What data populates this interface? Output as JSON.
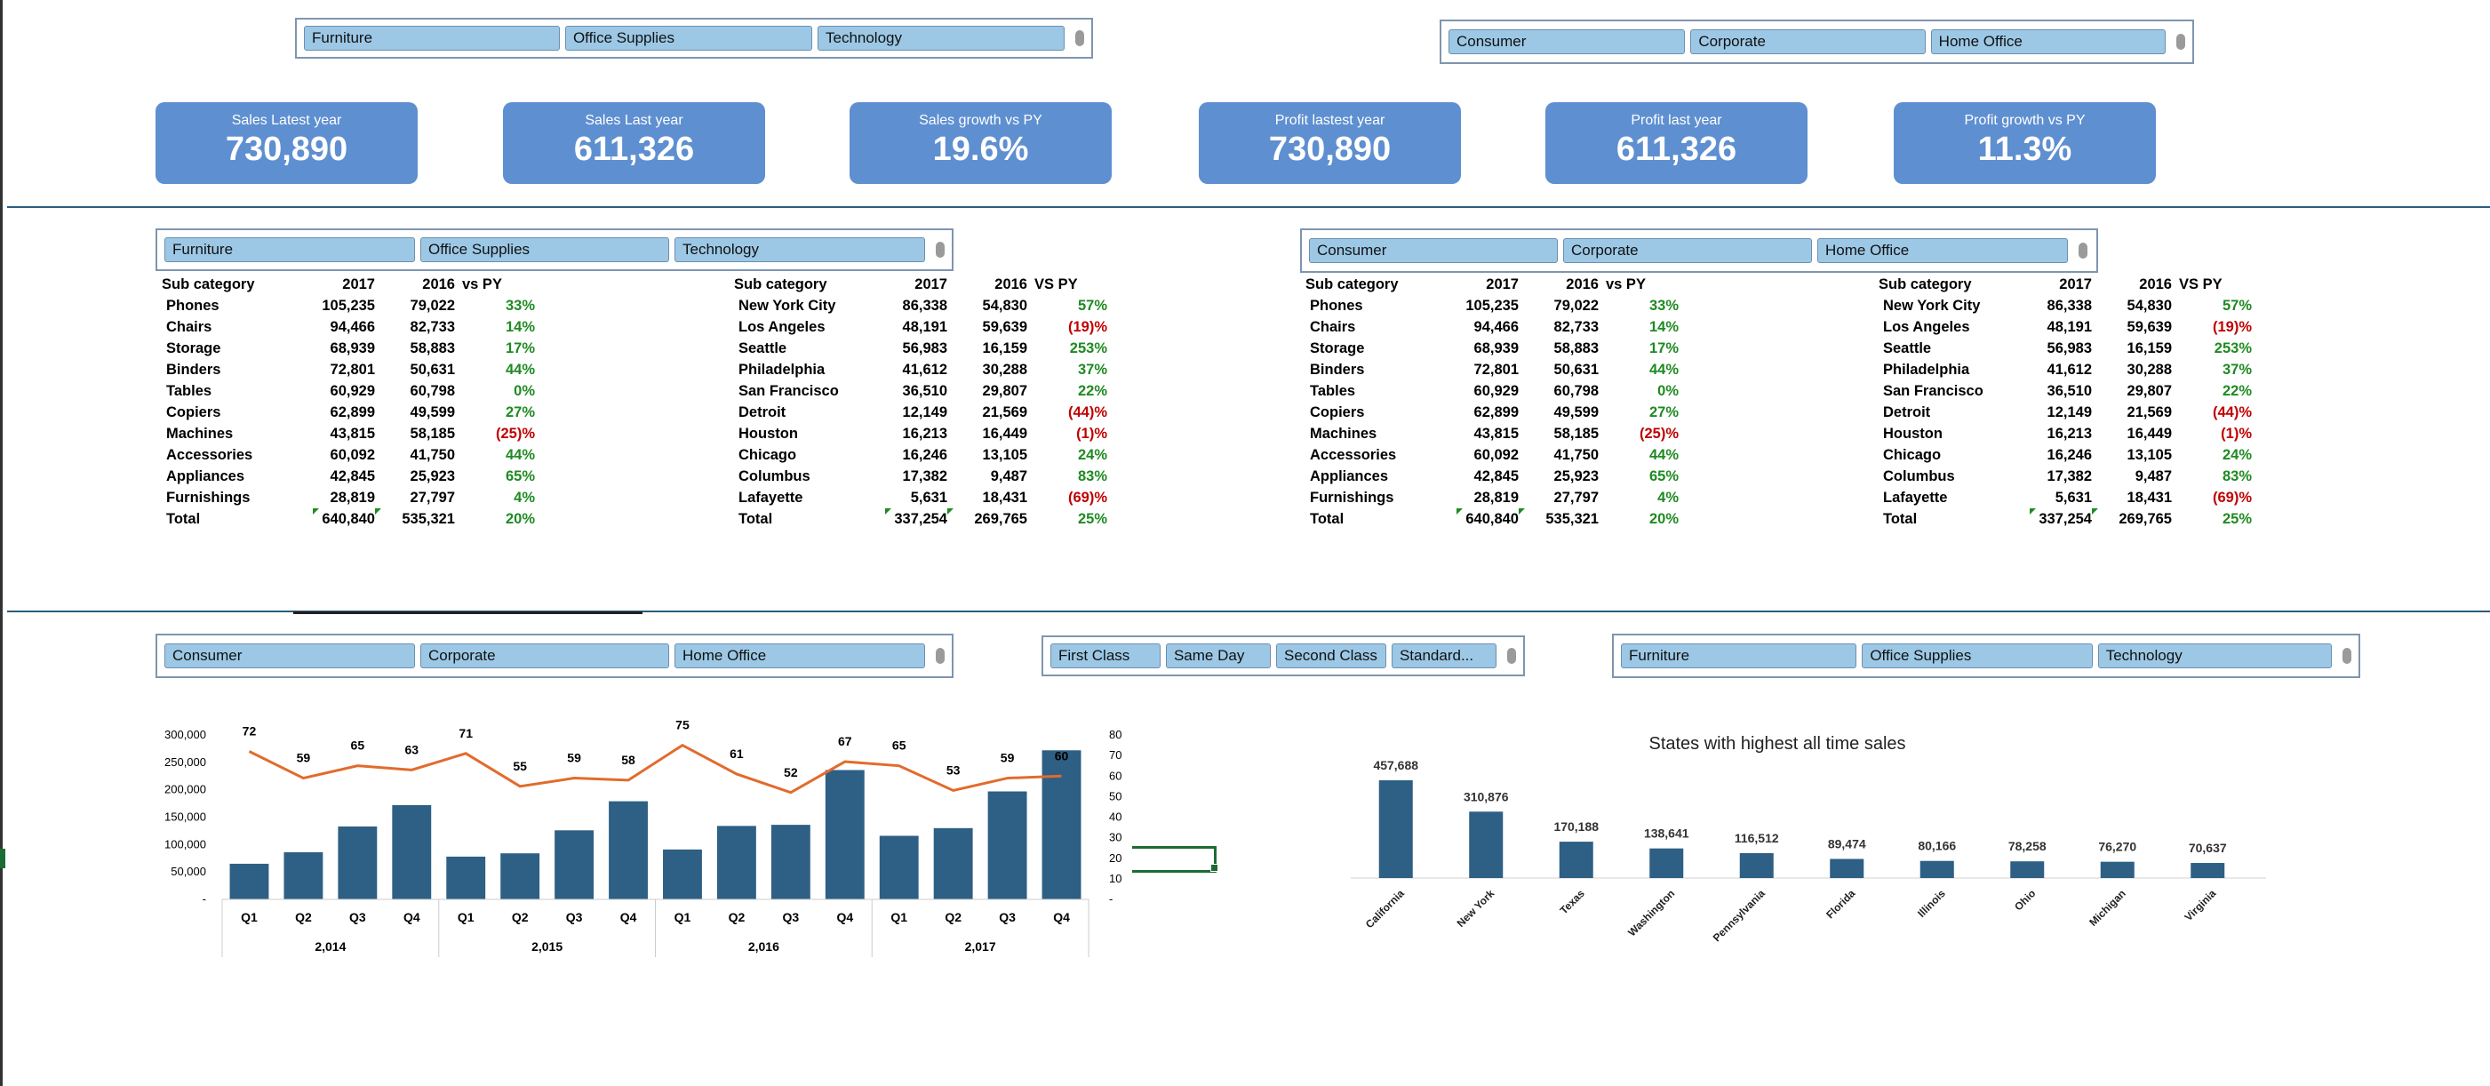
{
  "colors": {
    "kpi": "#5e8fd0",
    "bar": "#2e5f84",
    "line": "#e26b2c",
    "positive": "#1f8a21",
    "negative": "#c00000",
    "slicer_btn": "#9cc8e6"
  },
  "slicers": {
    "top_category": [
      "Furniture",
      "Office Supplies",
      "Technology"
    ],
    "top_segment": [
      "Consumer",
      "Corporate",
      "Home Office"
    ],
    "mid_category": [
      "Furniture",
      "Office Supplies",
      "Technology"
    ],
    "mid_segment": [
      "Consumer",
      "Corporate",
      "Home Office"
    ],
    "bottom_segment": [
      "Consumer",
      "Corporate",
      "Home Office"
    ],
    "bottom_ship": [
      "First Class",
      "Same Day",
      "Second Class",
      "Standard..."
    ],
    "bottom_category": [
      "Furniture",
      "Office Supplies",
      "Technology"
    ]
  },
  "kpis": [
    {
      "label": "Sales Latest year",
      "value": "730,890"
    },
    {
      "label": "Sales Last year",
      "value": "611,326"
    },
    {
      "label": "Sales growth vs PY",
      "value": "19.6%"
    },
    {
      "label": "Profit lastest year",
      "value": "730,890"
    },
    {
      "label": "Profit last year",
      "value": "611,326"
    },
    {
      "label": "Profit growth vs PY",
      "value": "11.3%"
    }
  ],
  "subcat_table": {
    "headers": [
      "Sub category",
      "2017",
      "2016",
      "vs PY"
    ],
    "rows": [
      [
        "Phones",
        "105,235",
        "79,022",
        "33%"
      ],
      [
        "Chairs",
        "94,466",
        "82,733",
        "14%"
      ],
      [
        "Storage",
        "68,939",
        "58,883",
        "17%"
      ],
      [
        "Binders",
        "72,801",
        "50,631",
        "44%"
      ],
      [
        "Tables",
        "60,929",
        "60,798",
        "0%"
      ],
      [
        "Copiers",
        "62,899",
        "49,599",
        "27%"
      ],
      [
        "Machines",
        "43,815",
        "58,185",
        "(25)%"
      ],
      [
        "Accessories",
        "60,092",
        "41,750",
        "44%"
      ],
      [
        "Appliances",
        "42,845",
        "25,923",
        "65%"
      ],
      [
        "Furnishings",
        "28,819",
        "27,797",
        "4%"
      ],
      [
        "Total",
        "640,840",
        "535,321",
        "20%"
      ]
    ]
  },
  "city_table": {
    "headers": [
      "Sub category",
      "2017",
      "2016",
      "VS PY"
    ],
    "rows": [
      [
        "New York City",
        "86,338",
        "54,830",
        "57%"
      ],
      [
        "Los Angeles",
        "48,191",
        "59,639",
        "(19)%"
      ],
      [
        "Seattle",
        "56,983",
        "16,159",
        "253%"
      ],
      [
        "Philadelphia",
        "41,612",
        "30,288",
        "37%"
      ],
      [
        "San Francisco",
        "36,510",
        "29,807",
        "22%"
      ],
      [
        "Detroit",
        "12,149",
        "21,569",
        "(44)%"
      ],
      [
        "Houston",
        "16,213",
        "16,449",
        "(1)%"
      ],
      [
        "Chicago",
        "16,246",
        "13,105",
        "24%"
      ],
      [
        "Columbus",
        "17,382",
        "9,487",
        "83%"
      ],
      [
        "Lafayette",
        "5,631",
        "18,431",
        "(69)%"
      ],
      [
        "Total",
        "337,254",
        "269,765",
        "25%"
      ]
    ]
  },
  "chart_data": [
    {
      "type": "bar",
      "series": [
        {
          "values": [
            65000,
            86000,
            133000,
            172000,
            78000,
            84000,
            126000,
            179000,
            91000,
            134000,
            136000,
            236000,
            116000,
            130000,
            197000,
            272000
          ]
        },
        {
          "type": "line",
          "values": [
            72,
            59,
            65,
            63,
            71,
            55,
            59,
            58,
            75,
            61,
            52,
            67,
            65,
            53,
            59,
            60
          ]
        }
      ],
      "categories": [
        "Q1",
        "Q2",
        "Q3",
        "Q4",
        "Q1",
        "Q2",
        "Q3",
        "Q4",
        "Q1",
        "Q2",
        "Q3",
        "Q4",
        "Q1",
        "Q2",
        "Q3",
        "Q4"
      ],
      "groups": [
        "2,014",
        "2,015",
        "2,016",
        "2,017"
      ],
      "y_ticks": [
        "300,000",
        "250,000",
        "200,000",
        "150,000",
        "100,000",
        "50,000",
        "-"
      ],
      "y2_ticks": [
        "80",
        "70",
        "60",
        "50",
        "40",
        "30",
        "20",
        "10",
        "-"
      ],
      "ylim": [
        0,
        300000
      ],
      "y2lim": [
        0,
        80
      ]
    },
    {
      "type": "bar",
      "title": "States with highest all time sales",
      "categories": [
        "California",
        "New York",
        "Texas",
        "Washington",
        "Pennsylvania",
        "Florida",
        "Illinois",
        "Ohio",
        "Michigan",
        "Virginia"
      ],
      "values": [
        457688,
        310876,
        170188,
        138641,
        116512,
        89474,
        80166,
        78258,
        76270,
        70637
      ],
      "labels": [
        "457,688",
        "310,876",
        "170,188",
        "138,641",
        "116,512",
        "89,474",
        "80,166",
        "78,258",
        "76,270",
        "70,637"
      ]
    }
  ]
}
